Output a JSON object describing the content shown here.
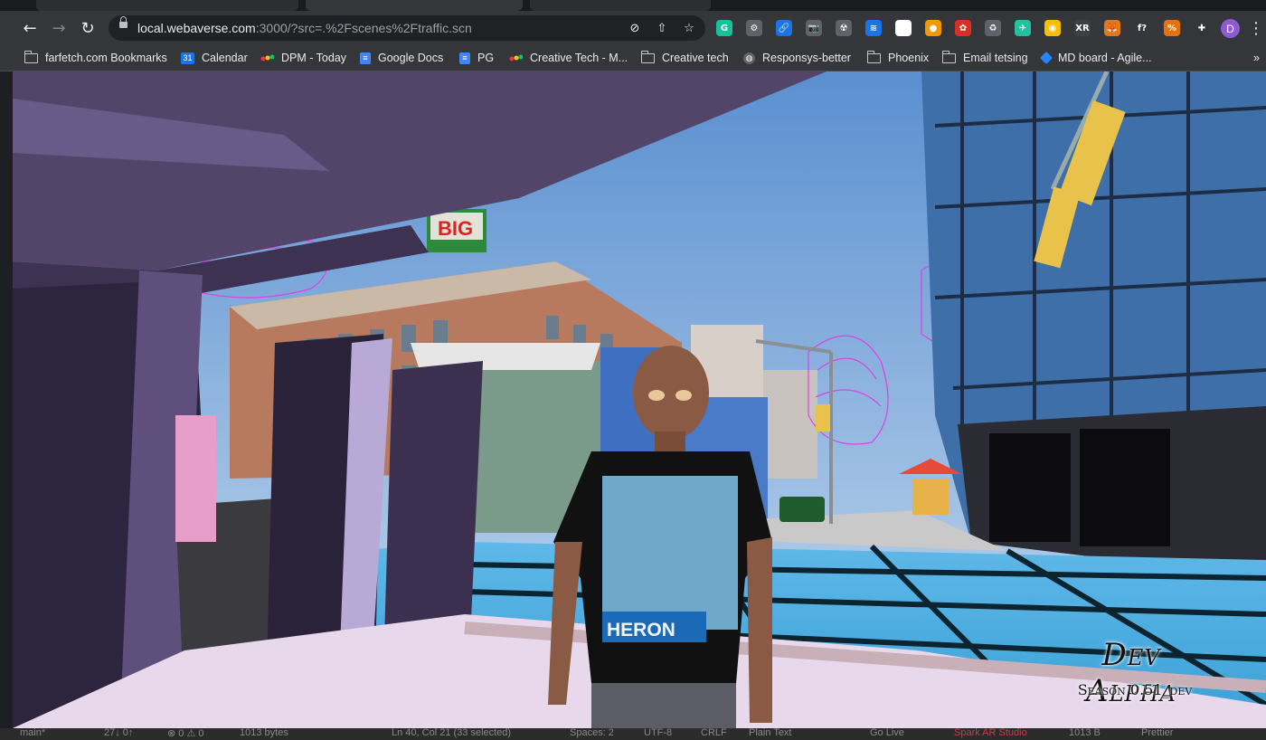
{
  "browser": {
    "tabs": [
      {
        "label": ""
      },
      {
        "label": ""
      },
      {
        "label": ""
      }
    ],
    "nav": {
      "back_icon": "back-arrow-icon",
      "forward_icon": "forward-arrow-icon",
      "reload_icon": "reload-icon"
    },
    "omnibox": {
      "host": "local.webaverse.com",
      "path": ":3000/?src=.%2Fscenes%2Ftraffic.scn",
      "icons": [
        "site-info-lock-icon",
        "camera-blocked-icon",
        "share-icon",
        "bookmark-star-icon"
      ]
    },
    "extensions": [
      {
        "name": "grammarly-icon",
        "glyph": "G",
        "color": "#15c39a"
      },
      {
        "name": "gear-extension-icon",
        "glyph": "⚙",
        "color": "#5f6368"
      },
      {
        "name": "link-extension-icon",
        "glyph": "🔗",
        "color": "#1a73e8"
      },
      {
        "name": "camera-extension-icon",
        "glyph": "📷",
        "color": "#5f6368"
      },
      {
        "name": "radiation-extension-icon",
        "glyph": "☢",
        "color": "#5f6368"
      },
      {
        "name": "layers-extension-icon",
        "glyph": "≋",
        "color": "#1a73e8"
      },
      {
        "name": "dots-extension-icon",
        "glyph": "•",
        "color": "#ffffff"
      },
      {
        "name": "flame-extension-icon",
        "glyph": "●",
        "color": "#f29900"
      },
      {
        "name": "ladybug-extension-icon",
        "glyph": "✿",
        "color": "#d93025"
      },
      {
        "name": "recycle-extension-icon",
        "glyph": "♻",
        "color": "#5f6368"
      },
      {
        "name": "bird-extension-icon",
        "glyph": "✈",
        "color": "#24c1a0"
      },
      {
        "name": "color-wheel-extension-icon",
        "glyph": "◉",
        "color": "#fbbc04"
      },
      {
        "name": "webxr-extension-icon",
        "glyph": "XR",
        "color": "#3c4043"
      },
      {
        "name": "metamask-fox-icon",
        "glyph": "🦊",
        "color": "#e2761b"
      },
      {
        "name": "function-extension-icon",
        "glyph": "f?",
        "color": "#35363a"
      },
      {
        "name": "percent-extension-icon",
        "glyph": "%",
        "color": "#e8710a"
      },
      {
        "name": "puzzle-extensions-icon",
        "glyph": "✚",
        "color": "#35363a"
      },
      {
        "name": "side-panel-icon",
        "glyph": "▮",
        "color": "#35363a"
      }
    ],
    "profile": {
      "initial": "D",
      "color": "#8e5bd1"
    }
  },
  "bookmarks": [
    {
      "label": "farfetch.com Bookmarks",
      "icon": "folder-icon"
    },
    {
      "label": "Calendar",
      "icon": "calendar-icon"
    },
    {
      "label": "DPM - Today",
      "icon": "monday-icon"
    },
    {
      "label": "Google Docs",
      "icon": "docs-icon"
    },
    {
      "label": "PG",
      "icon": "docs-icon"
    },
    {
      "label": "Creative Tech - M...",
      "icon": "monday-icon"
    },
    {
      "label": "Creative tech",
      "icon": "folder-icon"
    },
    {
      "label": "Responsys-better",
      "icon": "globe-icon"
    },
    {
      "label": "Phoenix",
      "icon": "folder-icon"
    },
    {
      "label": "Email tetsing",
      "icon": "folder-icon"
    },
    {
      "label": "MD board - Agile...",
      "icon": "diamond-icon"
    }
  ],
  "bookmarks_overflow": "»",
  "calendar_day": "31",
  "scene": {
    "sign_text": "BIG",
    "shirt_text": "HERON",
    "watermark_title": "Dev Alpha",
    "watermark_subtitle": "Season 0.51_dev"
  },
  "statusbar": {
    "items": [
      {
        "name": "git-branch",
        "text": "main*"
      },
      {
        "name": "sync-status",
        "text": "27↓ 0↑"
      },
      {
        "name": "problems",
        "text": "⊗ 0 ⚠ 0"
      },
      {
        "name": "file-size",
        "text": "1013 bytes"
      },
      {
        "name": "cursor-position",
        "text": "Ln 40, Col 21 (33 selected)"
      },
      {
        "name": "indentation",
        "text": "Spaces: 2"
      },
      {
        "name": "encoding",
        "text": "UTF-8"
      },
      {
        "name": "eol",
        "text": "CRLF"
      },
      {
        "name": "language-mode",
        "text": "Plain Text"
      },
      {
        "name": "go-live",
        "text": "Go Live"
      },
      {
        "name": "spark-ar",
        "text": "Spark AR Studio"
      },
      {
        "name": "file-size-short",
        "text": "1013 B"
      },
      {
        "name": "prettier",
        "text": "Prettier"
      }
    ]
  }
}
